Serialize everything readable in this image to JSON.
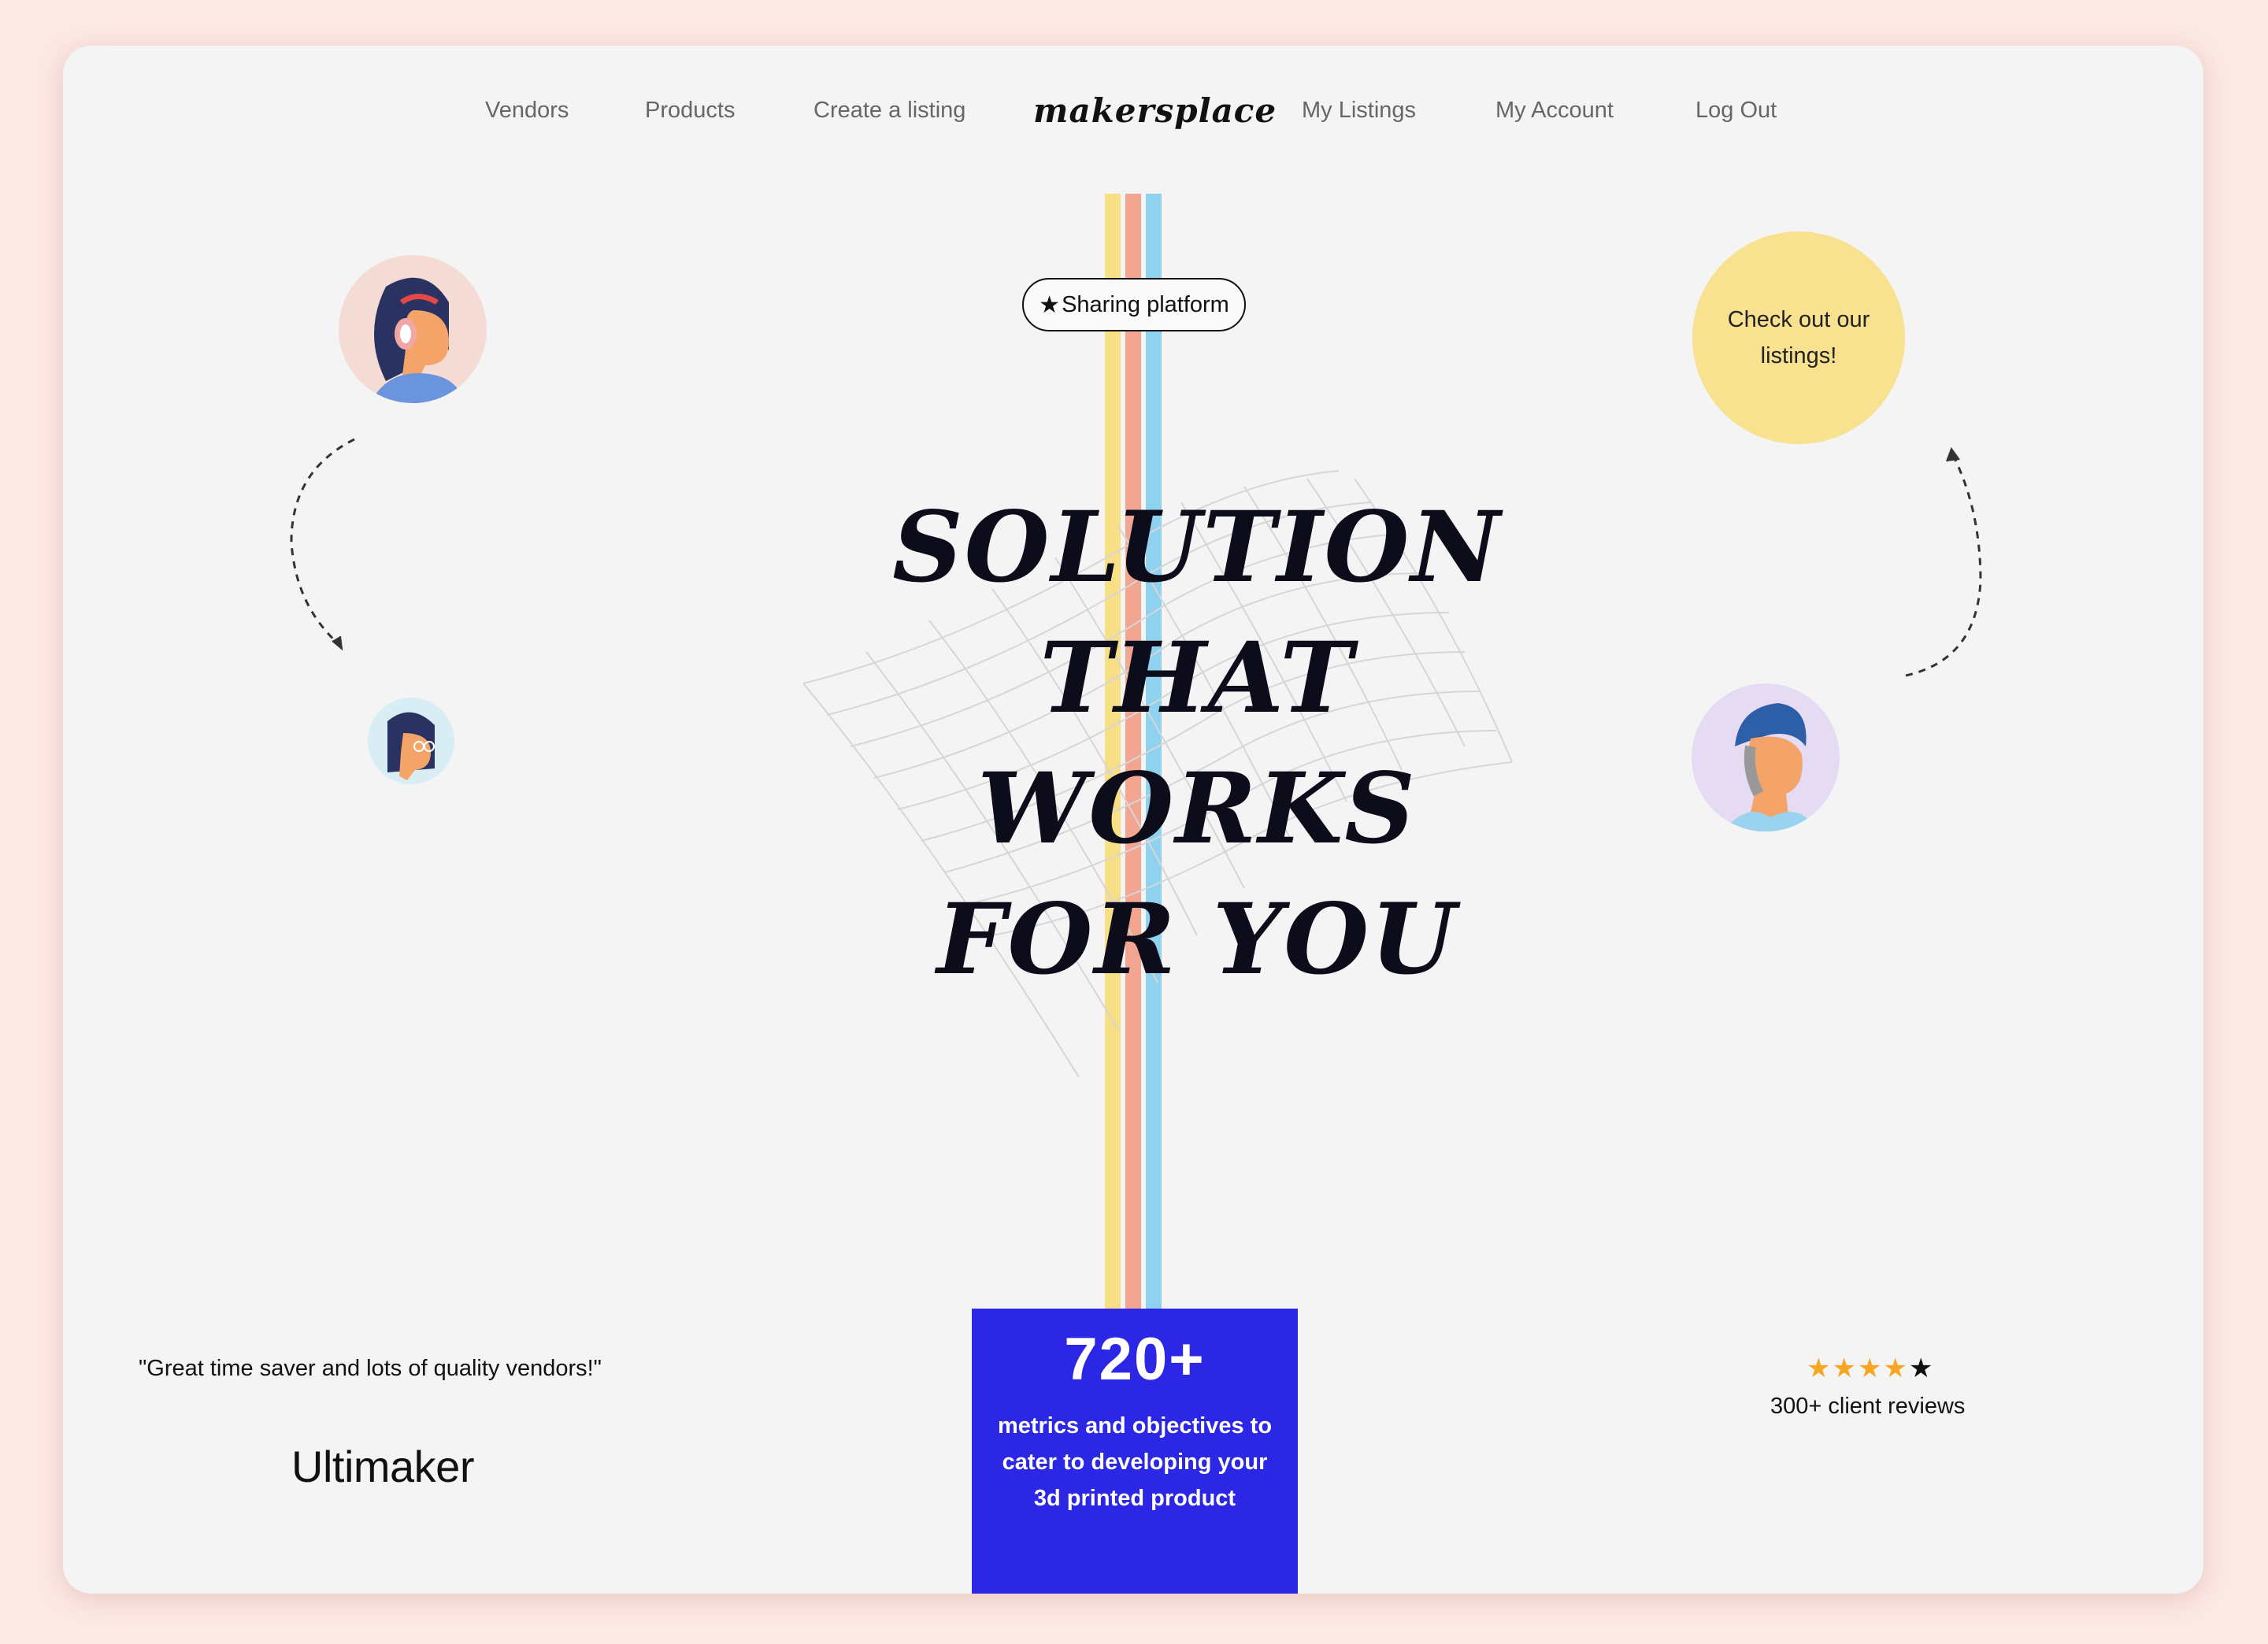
{
  "nav": {
    "links": [
      "Vendors",
      "Products",
      "Create a listing"
    ],
    "logo": "makersplace",
    "links_right": [
      "My Listings",
      "My Account",
      "Log Out"
    ]
  },
  "hero": {
    "badge": "Sharing platform",
    "headline": [
      "SOLUTION",
      "THAT",
      "WORKS",
      "FOR YOU"
    ],
    "cta": "Check out our listings!"
  },
  "testimonial": {
    "quote": "\"Great time saver and lots of quality vendors!\"",
    "brand": "Ultimaker"
  },
  "stat": {
    "number": "720+",
    "text": "metrics and objectives to cater to developing your 3d printed product"
  },
  "reviews": {
    "rating": 4,
    "max": 5,
    "label": "300+ client reviews"
  },
  "colors": {
    "background": "#fce8e4",
    "card": "#f4f4f4",
    "stat_box": "#2b27e4",
    "cta_circle": "#f8e18f",
    "stripe_yellow": "#f8df86",
    "stripe_salmon": "#f2a590",
    "stripe_blue": "#8fd2ef",
    "star": "#f5a623"
  }
}
